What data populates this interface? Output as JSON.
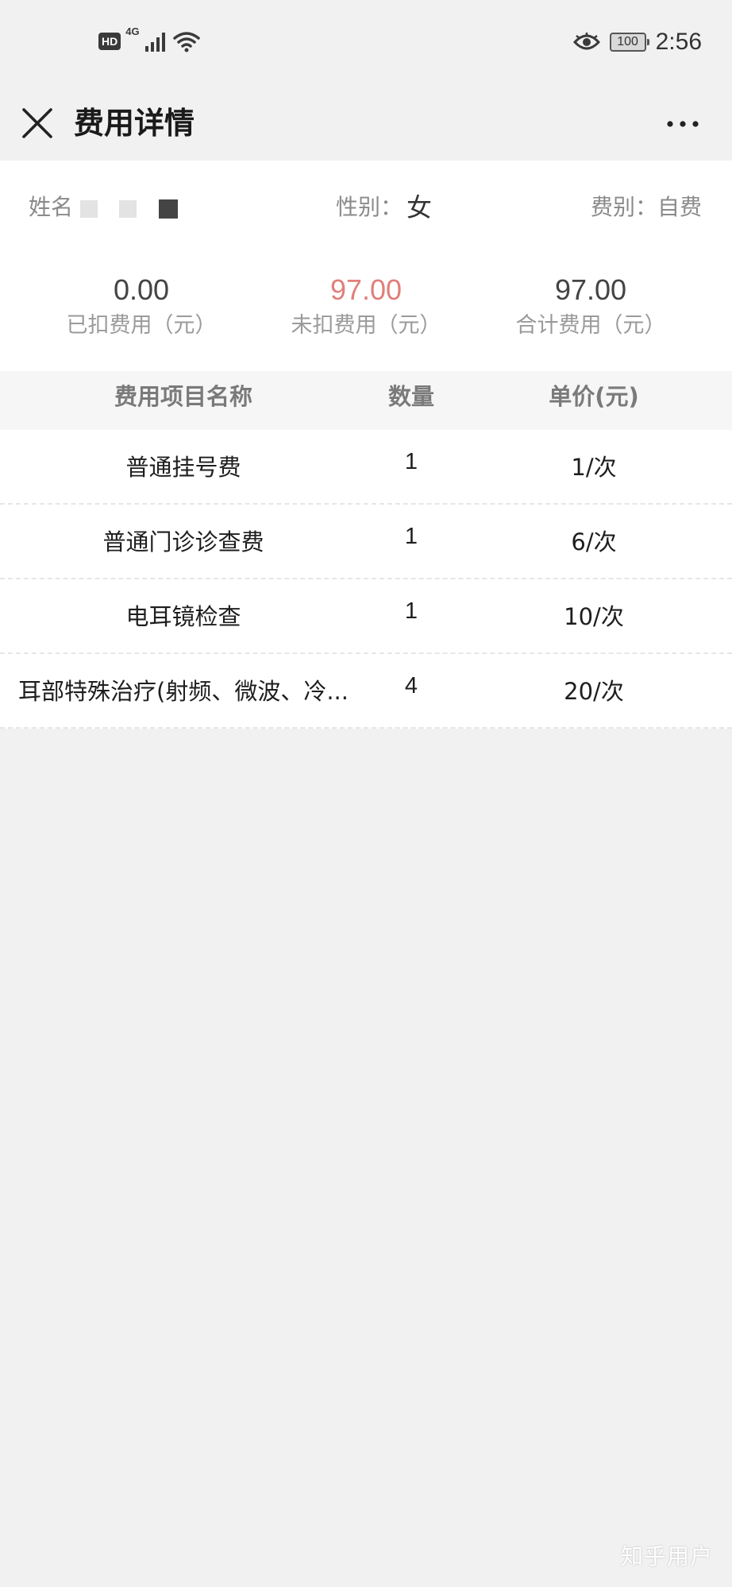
{
  "status_bar": {
    "hd": "HD",
    "network": "4G",
    "battery": "100",
    "time": "2:56"
  },
  "nav": {
    "title": "费用详情",
    "close_icon": "close-icon",
    "more_icon": "more-horizontal-icon"
  },
  "patient": {
    "name_label": "姓名",
    "gender_label": "性别：",
    "gender_value": "女",
    "fee_type": "费别：自费"
  },
  "summary": {
    "deducted_value": "0.00",
    "deducted_label": "已扣费用（元）",
    "undeducted_value": "97.00",
    "undeducted_label": "未扣费用（元）",
    "total_value": "97.00",
    "total_label": "合计费用（元）",
    "undeducted_color": "#e07f79"
  },
  "table": {
    "headers": {
      "name": "费用项目名称",
      "qty": "数量",
      "price": "单价(元)"
    },
    "rows": [
      {
        "name": "普通挂号费",
        "qty": "1",
        "price": "1/次"
      },
      {
        "name": "普通门诊诊查费",
        "qty": "1",
        "price": "6/次"
      },
      {
        "name": "电耳镜检查",
        "qty": "1",
        "price": "10/次"
      },
      {
        "name": "耳部特殊治疗(射频、微波、冷...",
        "qty": "4",
        "price": "20/次"
      }
    ]
  },
  "watermark": "知乎用户"
}
